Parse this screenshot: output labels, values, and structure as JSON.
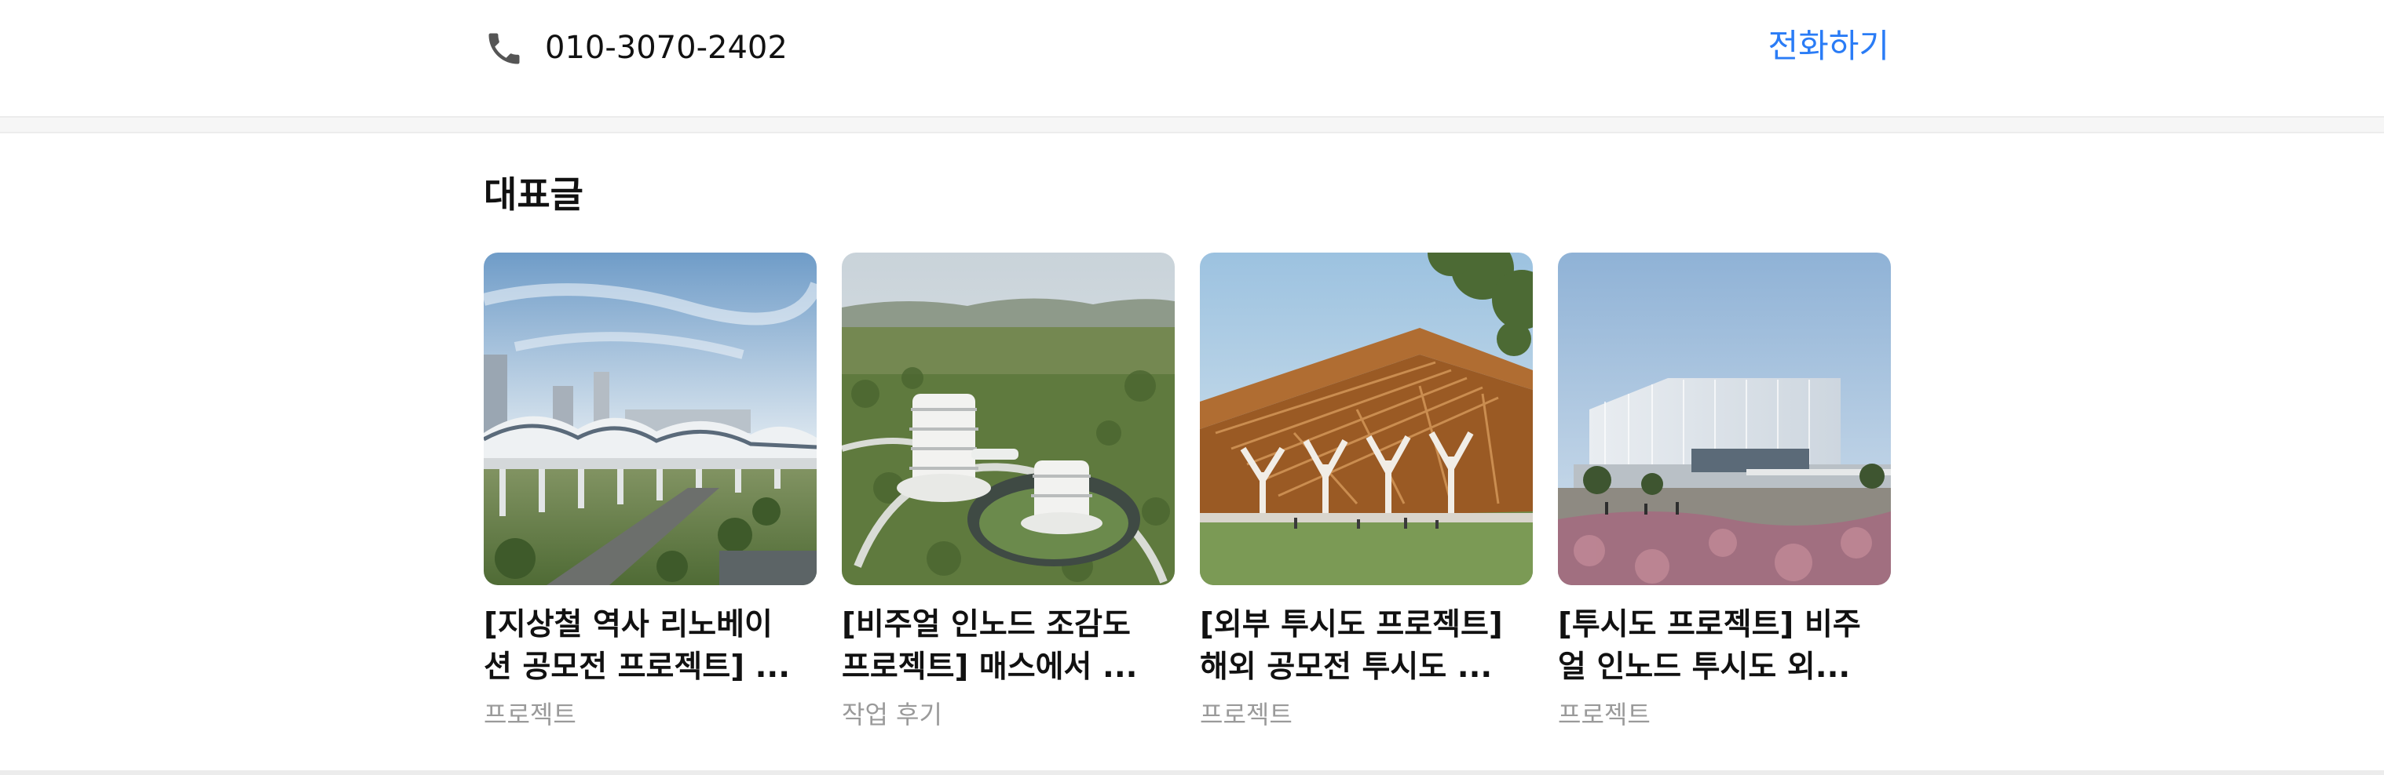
{
  "contact": {
    "phone_icon": "phone-icon",
    "phone_number": "010-3070-2402",
    "call_label": "전화하기",
    "accent_color": "#2a7cf6"
  },
  "featured": {
    "title": "대표글",
    "posts": [
      {
        "title_line1": "[지상철 역사 리노베이",
        "title_line2": "션 공모전 프로젝트] ...",
        "category": "프로젝트"
      },
      {
        "title_line1": "[비주얼 인노드 조감도",
        "title_line2": "프로젝트] 매스에서 ...",
        "category": "작업 후기"
      },
      {
        "title_line1": "[외부 투시도 프로젝트]",
        "title_line2": "해외 공모전 투시도 ...",
        "category": "프로젝트"
      },
      {
        "title_line1": "[투시도 프로젝트] 비주",
        "title_line2": "얼 인노드 투시도 외...",
        "category": "프로젝트"
      }
    ]
  }
}
